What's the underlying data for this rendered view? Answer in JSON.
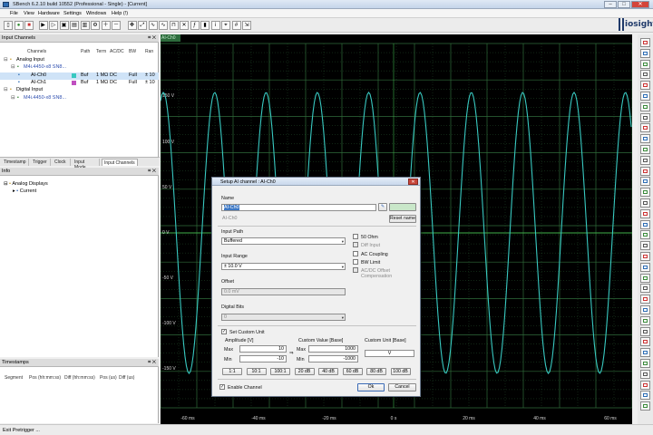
{
  "window": {
    "title": "SBench 6.2.10 build 10552 (Professional - Single) - [Current]",
    "min": "–",
    "max": "□",
    "close": "✕"
  },
  "menu": [
    "File",
    "View",
    "Hardware",
    "Settings",
    "Windows",
    "Help (!)"
  ],
  "toolbar": {
    "icons": [
      "new-doc-icon",
      "record-icon",
      "stop-icon",
      "start-icon",
      "run-icon",
      "save-icon",
      "open-icon",
      "print-icon",
      "settings-icon",
      "zoom-in-icon",
      "zoom-out-icon",
      "cursor-icon",
      "fit-icon",
      "wave-icon",
      "analog-display-icon",
      "digital-display-icon",
      "xy-display-icon",
      "fft-icon",
      "histogram-icon",
      "info-icon",
      "marker-icon",
      "grid-icon",
      "export-icon"
    ]
  },
  "logo": {
    "text": "iosight"
  },
  "input_channels_panel": {
    "title": "Input Channels",
    "columns": [
      "Channels",
      "Path",
      "Term",
      "AC/DC",
      "BW",
      "Ran"
    ],
    "rows": [
      {
        "indent": 0,
        "label": "Analog Input",
        "cells": [
          "",
          "",
          "",
          "",
          ""
        ]
      },
      {
        "indent": 1,
        "label": "M4i.4450-x8 SN8...",
        "cells": [
          "",
          "",
          "",
          "",
          ""
        ],
        "link": true
      },
      {
        "indent": 2,
        "label": "AI-Ch0",
        "cells": [
          "Buf",
          "1 MΩ",
          "DC",
          "Full",
          "± 10"
        ],
        "selected": true
      },
      {
        "indent": 2,
        "label": "AI-Ch1",
        "cells": [
          "Buf",
          "1 MΩ",
          "DC",
          "Full",
          "± 10"
        ]
      },
      {
        "indent": 0,
        "label": "Digital Input",
        "cells": [
          "",
          "",
          "",
          "",
          ""
        ]
      },
      {
        "indent": 1,
        "label": "M4i.4450-x8 SN8...",
        "cells": [
          "",
          "",
          "",
          "",
          ""
        ],
        "link": true
      }
    ]
  },
  "tabs": [
    "Timestamp",
    "Trigger",
    "Clock",
    "Input Mode",
    "Input Channels"
  ],
  "active_tab": "Input Channels",
  "info_panel": {
    "title": "Info",
    "items": [
      {
        "indent": 0,
        "label": "Analog Displays"
      },
      {
        "indent": 1,
        "label": "Current"
      }
    ]
  },
  "timestamps_panel": {
    "title": "Timestamps",
    "columns": [
      "Segment",
      "Pos (hh:mm:ss)",
      "Diff (hh:mm:ss)",
      "Pos (us)",
      "Diff (us)"
    ]
  },
  "status": "Exit Pretrigger ...",
  "scope": {
    "tab_label": "AI-Ch0",
    "trace_color": "#38c8c0",
    "grid_color": "#2f6b3a",
    "y_ticks": [
      "150 V",
      "100 V",
      "50 V",
      "0 V",
      "-50 V",
      "-100 V",
      "-150 V"
    ],
    "x_ticks": [
      "-60 ms",
      "-40 ms",
      "-20 ms",
      "0 s",
      "20 ms",
      "40 ms",
      "60 ms"
    ]
  },
  "dialog": {
    "title": "Setup AI channel : AI-Ch0",
    "close": "✕",
    "name_label": "Name",
    "name_value": "AI-Ch0",
    "name_default": "AI-Ch0",
    "color_btn": "",
    "reset_name": "Reset name",
    "input_path_label": "Input Path",
    "input_path_value": "Buffered",
    "input_range_label": "Input Range",
    "input_range_value": "± 10.0 V",
    "offset_label": "Offset",
    "offset_value": "0.0 mV",
    "digital_bits_label": "Digital Bits",
    "digital_bits_value": "0",
    "checks": [
      {
        "label": "50 Ohm",
        "checked": false,
        "enabled": true
      },
      {
        "label": "Diff Input",
        "checked": false,
        "enabled": false
      },
      {
        "label": "AC Coupling",
        "checked": false,
        "enabled": true
      },
      {
        "label": "BW Limit",
        "checked": false,
        "enabled": true
      },
      {
        "label": "AC/DC Offset Compensation",
        "checked": false,
        "enabled": false
      }
    ],
    "custom_unit_label": "Set Custom Unit",
    "custom_unit_checked": true,
    "amplitude_label": "Amplitude [V]",
    "custom_value_label": "Custom Value [Base]",
    "custom_unit_base_label": "Custom Unit [Base]",
    "max_label": "Max",
    "min_label": "Min",
    "amp_max": "10",
    "amp_min": "-10",
    "arrow": "⇒",
    "cv_max_label": "Max",
    "cv_min_label": "Min",
    "cv_max": "1000",
    "cv_min": "-1000",
    "unit_value": "V",
    "ratio_buttons": [
      "1:1",
      "10:1",
      "100:1",
      "20 dB",
      "40 dB",
      "60 dB",
      "80 dB",
      "100 dB"
    ],
    "enable_label": "Enable Channel",
    "enable_checked": true,
    "ok": "Ok",
    "cancel": "Cancel"
  }
}
